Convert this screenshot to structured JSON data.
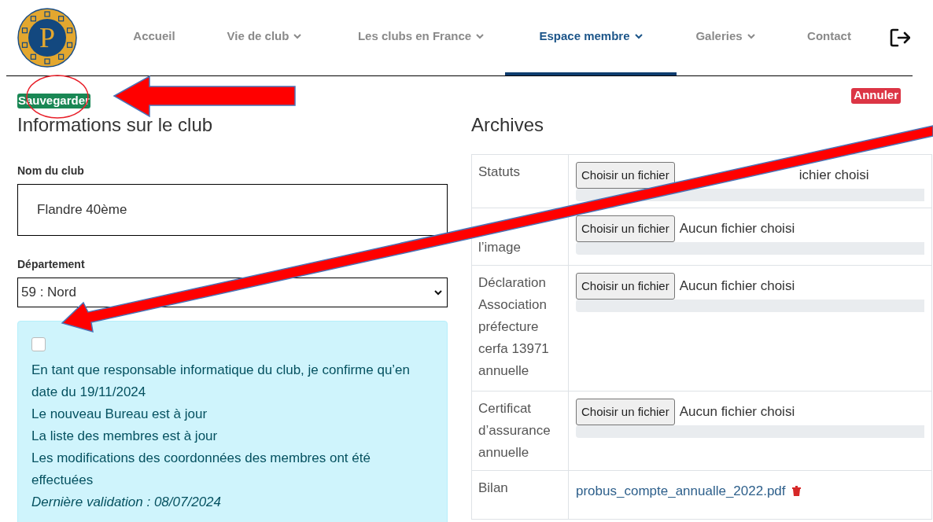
{
  "logo": {
    "letter": "P"
  },
  "nav": [
    {
      "label": "Accueil",
      "dropdown": false,
      "selected": false
    },
    {
      "label": "Vie de club",
      "dropdown": true,
      "selected": false
    },
    {
      "label": "Les clubs en France",
      "dropdown": true,
      "selected": false
    },
    {
      "label": "Espace membre",
      "dropdown": true,
      "selected": true
    },
    {
      "label": "Galeries",
      "dropdown": true,
      "selected": false
    },
    {
      "label": "Contact",
      "dropdown": false,
      "selected": false
    }
  ],
  "actions": {
    "save": "Sauvegarder",
    "cancel": "Annuler"
  },
  "club_info": {
    "title": "Informations sur le club",
    "fields": [
      {
        "kind": "text",
        "label": "Nom du club",
        "value": "Flandre 40ème"
      },
      {
        "kind": "select",
        "label": "Département",
        "value": "59 : Nord"
      }
    ],
    "confirmation": {
      "checked": false,
      "lines": [
        "En tant que responsable informatique du club, je confirme qu’en date du 19/11/2024",
        "Le nouveau Bureau est à jour",
        "La liste des membres est à jour",
        "Les modifications des coordonnées des membres ont été effectuées"
      ],
      "last_validation": "Dernière validation : 08/07/2024"
    }
  },
  "archives": {
    "title": "Archives",
    "rows": [
      {
        "kind": "upload",
        "label": "Statuts",
        "button": "Choisir un fichier",
        "file_status": "ichier choisi",
        "partly_covered": true,
        "level": 0
      },
      {
        "kind": "upload",
        "label": "l’image",
        "button": "Choisir un fichier",
        "file_status": "Aucun fichier choisi",
        "level": 0
      },
      {
        "kind": "upload",
        "label": "Déclaration Association préfecture cerfa 13971 annuelle",
        "button": "Choisir un fichier",
        "file_status": "Aucun fichier choisi",
        "level": 0
      },
      {
        "kind": "upload",
        "label": "Certificat d’assurance annuelle",
        "button": "Choisir un fichier",
        "file_status": "Aucun fichier choisi",
        "level": 0
      },
      {
        "kind": "file",
        "label": "Bilan",
        "link": "probus_compte_annualle_2022.pdf"
      }
    ]
  },
  "annotations": [
    {
      "kind": "ellipse"
    },
    {
      "kind": "arrow"
    },
    {
      "kind": "arrow"
    }
  ]
}
